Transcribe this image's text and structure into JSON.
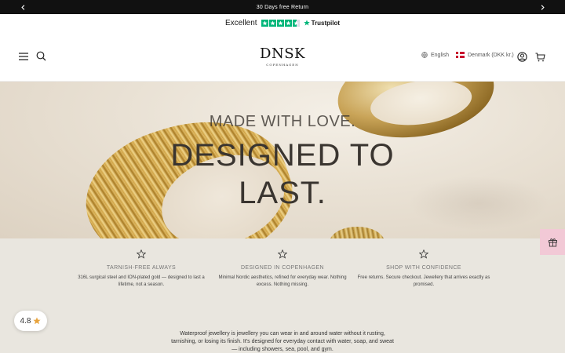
{
  "announcement": {
    "text": "30 Days free Return",
    "prev_icon": "chevron-left-icon",
    "next_icon": "chevron-right-icon"
  },
  "trustpilot": {
    "rating_word": "Excellent",
    "stars": 4.5,
    "brand": "Trustpilot",
    "star_color": "#00b67a"
  },
  "header": {
    "logo_wordmark": "DNSK",
    "logo_subtitle": "COPENHAGEN",
    "language": "English",
    "country": "Denmark (DKK kr.)",
    "icons": [
      "menu-icon",
      "search-icon",
      "globe-icon",
      "account-icon",
      "cart-icon"
    ]
  },
  "hero": {
    "kicker": "MADE WITH LOVE.",
    "headline": "DESIGNED TO LAST."
  },
  "features": [
    {
      "icon": "star-outline-icon",
      "title": "TARNISH-FREE ALWAYS",
      "description": "316L surgical steel and ION-plated gold — designed to last a lifetime, not a season."
    },
    {
      "icon": "star-outline-icon",
      "title": "DESIGNED IN COPENHAGEN",
      "description": "Minimal Nordic aesthetics, refined for everyday wear. Nothing excess. Nothing missing."
    },
    {
      "icon": "star-outline-icon",
      "title": "SHOP WITH CONFIDENCE",
      "description": "Free returns. Secure checkout. Jewellery that arrives exactly as promised."
    }
  ],
  "rating_badge": {
    "value": "4.8",
    "icon": "star-icon",
    "star_color": "#e8a33c"
  },
  "gift_tab": {
    "icon": "gift-icon",
    "color": "#f2c9d6"
  },
  "body_copy": "Waterproof jewellery is jewellery you can wear in and around water without it rusting, tarnishing, or losing its finish. It's designed for everyday contact with water, soap, and sweat — including showers, sea, pool, and gym."
}
